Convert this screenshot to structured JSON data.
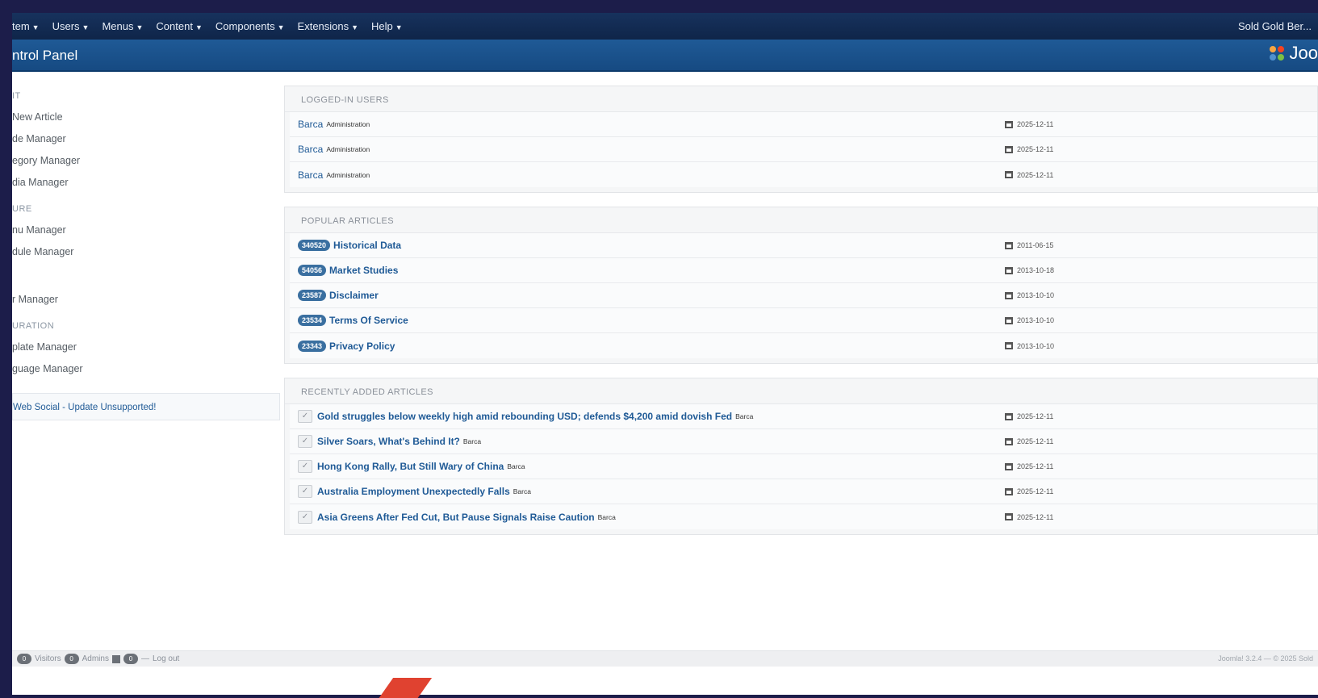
{
  "topbar": {
    "menu": [
      "tem",
      "Users",
      "Menus",
      "Content",
      "Components",
      "Extensions",
      "Help"
    ],
    "user": "Sold Gold Ber..."
  },
  "header": {
    "title": "ntrol Panel",
    "brand": "Joo"
  },
  "sidebar": {
    "sections": [
      {
        "heading": "IT",
        "links": [
          "New Article",
          "de Manager",
          "egory Manager",
          "dia Manager"
        ]
      },
      {
        "heading": "URE",
        "links": [
          "nu Manager",
          "dule Manager"
        ]
      },
      {
        "heading": "",
        "links": [
          "r Manager"
        ]
      },
      {
        "heading": "URATION",
        "links": [
          "plate Manager",
          "guage Manager"
        ]
      }
    ],
    "alert": "Web Social - Update Unsupported!"
  },
  "logged_in": {
    "heading": "LOGGED-IN USERS",
    "rows": [
      {
        "name": "Barca",
        "role": "Administration",
        "date": "2025-12-11"
      },
      {
        "name": "Barca",
        "role": "Administration",
        "date": "2025-12-11"
      },
      {
        "name": "Barca",
        "role": "Administration",
        "date": "2025-12-11"
      }
    ]
  },
  "popular": {
    "heading": "POPULAR ARTICLES",
    "rows": [
      {
        "hits": "340520",
        "title": "Historical Data",
        "date": "2011-06-15"
      },
      {
        "hits": "54056",
        "title": "Market Studies",
        "date": "2013-10-18"
      },
      {
        "hits": "23587",
        "title": "Disclaimer",
        "date": "2013-10-10"
      },
      {
        "hits": "23534",
        "title": "Terms Of Service",
        "date": "2013-10-10"
      },
      {
        "hits": "23343",
        "title": "Privacy Policy",
        "date": "2013-10-10"
      }
    ]
  },
  "recent": {
    "heading": "RECENTLY ADDED ARTICLES",
    "rows": [
      {
        "title": "Gold struggles below weekly high amid rebounding USD; defends $4,200 amid dovish Fed",
        "author": "Barca",
        "date": "2025-12-11"
      },
      {
        "title": "Silver Soars, What's Behind It?",
        "author": "Barca",
        "date": "2025-12-11"
      },
      {
        "title": "Hong Kong Rally, But Still Wary of China",
        "author": "Barca",
        "date": "2025-12-11"
      },
      {
        "title": "Australia Employment Unexpectedly Falls",
        "author": "Barca",
        "date": "2025-12-11"
      },
      {
        "title": "Asia Greens After Fed Cut, But Pause Signals Raise Caution",
        "author": "Barca",
        "date": "2025-12-11"
      }
    ]
  },
  "footer": {
    "visitors_count": "0",
    "visitors_label": "Visitors",
    "admins_count": "0",
    "admins_label": "Admins",
    "messages_count": "0",
    "logout": "Log out",
    "copyright": "Joomla! 3.2.4 — © 2025 Sold"
  }
}
